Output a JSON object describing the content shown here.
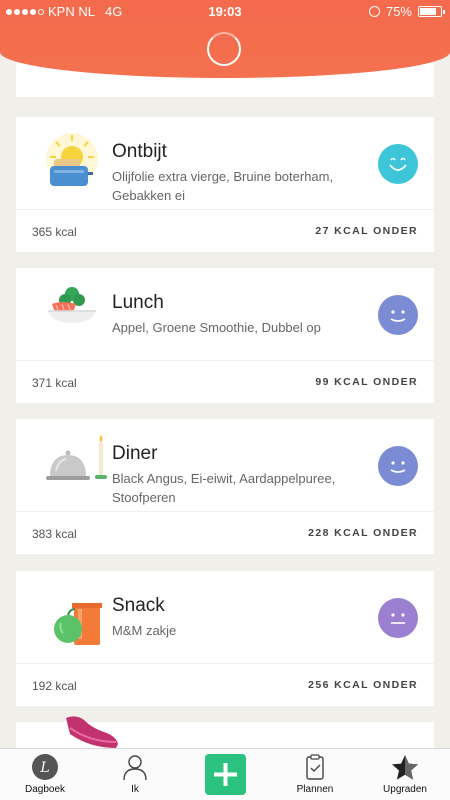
{
  "status_bar": {
    "carrier": "KPN NL",
    "network": "4G",
    "time": "19:03",
    "battery": "75%"
  },
  "meals": [
    {
      "title": "Ontbijt",
      "items": "Olijfolie extra vierge, Bruine boterham, Gebakken ei",
      "kcal": "365 kcal",
      "difference": "27 KCAL ONDER",
      "icon": "toaster-sun-icon",
      "mood": "happy",
      "mood_color": "#3dc6d8"
    },
    {
      "title": "Lunch",
      "items": "Appel, Groene Smoothie, Dubbel op",
      "kcal": "371 kcal",
      "difference": "99 KCAL ONDER",
      "icon": "salmon-plate-icon",
      "mood": "content",
      "mood_color": "#7b8bd4"
    },
    {
      "title": "Diner",
      "items": "Black Angus, Ei-eiwit, Aardappelpuree, Stoofperen",
      "kcal": "383 kcal",
      "difference": "228 KCAL ONDER",
      "icon": "cloche-candle-icon",
      "mood": "content",
      "mood_color": "#7b8bd4"
    },
    {
      "title": "Snack",
      "items": "M&M zakje",
      "kcal": "192 kcal",
      "difference": "256 KCAL ONDER",
      "icon": "apple-juice-icon",
      "mood": "neutral",
      "mood_color": "#9b7fd0"
    }
  ],
  "tabbar": {
    "diary": "Dagboek",
    "me": "Ik",
    "add": "add-icon",
    "plans": "Plannen",
    "upgrade": "Upgraden"
  },
  "colors": {
    "header": "#f36a4c",
    "add_button": "#2bc17e",
    "background": "#f0efea"
  }
}
